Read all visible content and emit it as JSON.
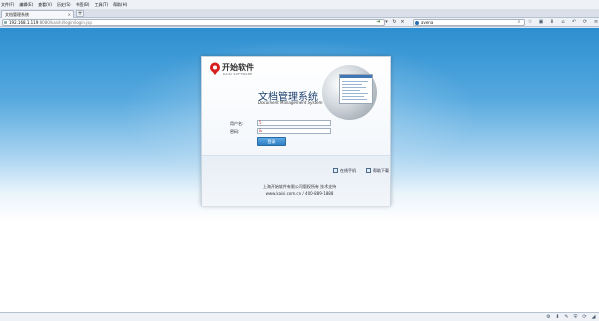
{
  "browser": {
    "menu": [
      "文件(F)",
      "编辑(E)",
      "查看(V)",
      "历史(S)",
      "书签(B)",
      "工具(T)",
      "帮助(H)"
    ],
    "tab_title": "文档管理系统",
    "tab_close": "×",
    "new_tab": "+",
    "url_host": "192.168.1.119",
    "url_path": ":8080/kaishi/login/login.jsp",
    "search_text": "avena"
  },
  "brand": {
    "name_cn": "开始软件",
    "name_en": "KAISI SOFTWARE"
  },
  "login": {
    "title": "文档管理系统",
    "subtitle": "Document Management System",
    "username_label": "用户名:",
    "username_value": "5",
    "password_label": "密码:",
    "password_value": "&",
    "submit_label": "登录",
    "link_client": "在线手机",
    "link_help": "帮助下载"
  },
  "footer": {
    "line1": "上海开始软件有限公司版权所有 技术支持",
    "line2": "www.kaisi.com.cn / 400-889-1888"
  },
  "colors": {
    "accent": "#2f7fc4",
    "header_gradient_top": "#2d8fd0",
    "title_color": "#1d3f6e"
  }
}
